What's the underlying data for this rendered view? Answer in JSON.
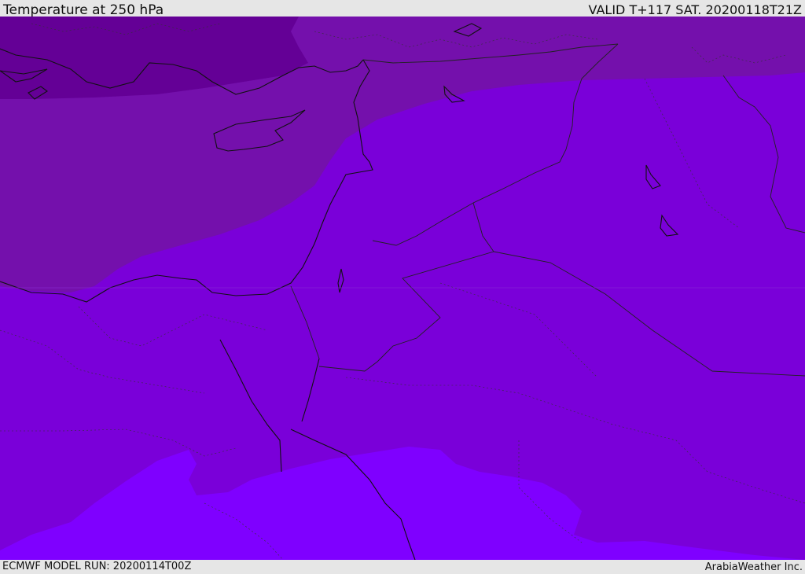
{
  "header": {
    "title": "Temperature at 250 hPa",
    "valid_time": "VALID T+117 SAT. 20200118T21Z"
  },
  "footer": {
    "model_run": "ECMWF MODEL RUN: 20200114T00Z",
    "credit": "ArabiaWeather Inc."
  },
  "map": {
    "colors": {
      "coldest_band": "#640096",
      "cold_band": "#7410ac",
      "mid_band": "#7a00d9",
      "warm_band": "#7f00ff",
      "coastline": "#111111",
      "borders": "#222222"
    }
  }
}
